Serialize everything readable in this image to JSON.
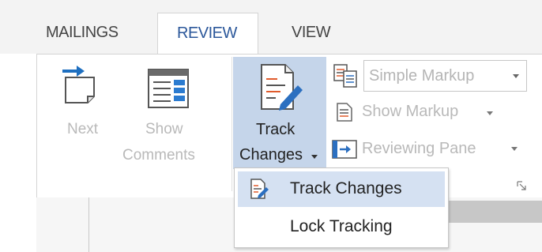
{
  "tabs": [
    {
      "label": "MAILINGS"
    },
    {
      "label": "REVIEW"
    },
    {
      "label": "VIEW"
    }
  ],
  "ribbon": {
    "next_label": "Next",
    "show_comments_line1": "Show",
    "show_comments_line2": "Comments",
    "track_changes_line1": "Track",
    "track_changes_line2": "Changes",
    "markup_value": "Simple Markup",
    "show_markup_label": "Show Markup",
    "reviewing_pane_label": "Reviewing Pane"
  },
  "menu": {
    "items": [
      {
        "label": "Track Changes"
      },
      {
        "label": "Lock Tracking"
      }
    ]
  },
  "colors": {
    "active_tab_text": "#2b579a",
    "selected_button_bg": "#c5d5ea",
    "hover_item_bg": "#d5e1f2",
    "disabled_text": "#b9b9b9"
  }
}
